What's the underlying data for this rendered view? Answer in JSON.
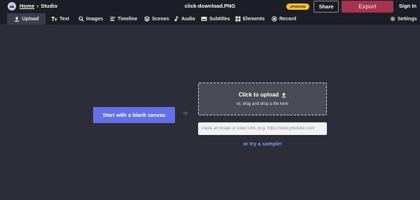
{
  "header": {
    "breadcrumb_home": "Home",
    "breadcrumb_separator": "›",
    "breadcrumb_current": "Studio",
    "file_name": "click-download.PNG",
    "upgrade_label": "UPGRADE",
    "share_label": "Share",
    "export_label": "Export",
    "signin_label": "Sign In"
  },
  "toolbar": {
    "items": [
      {
        "label": "Upload",
        "icon": "upload-icon",
        "active": true
      },
      {
        "label": "Text",
        "icon": "text-icon"
      },
      {
        "label": "Images",
        "icon": "search-icon"
      },
      {
        "label": "Timeline",
        "icon": "timeline-icon"
      },
      {
        "label": "Scenes",
        "icon": "scenes-icon"
      },
      {
        "label": "Audio",
        "icon": "music-note-icon"
      },
      {
        "label": "Subtitles",
        "icon": "subtitles-icon"
      },
      {
        "label": "Elements",
        "icon": "elements-icon"
      },
      {
        "label": "Record",
        "icon": "record-icon"
      }
    ],
    "settings_label": "Settings"
  },
  "main": {
    "blank_canvas_label": "Start with a blank canvas",
    "or_label": "or",
    "dropzone_title": "Click to upload",
    "dropzone_subtitle": "or, drag and drop a file here",
    "url_placeholder": "Paste an image or video URL (e.g. https://www.youtube.com/",
    "sample_label": "or try a sample!"
  },
  "colors": {
    "background": "#2c2d38",
    "bar": "#1c1d26",
    "accent": "#6470e6",
    "export": "#a5344f",
    "upgrade": "#f6c22f",
    "link": "#8e96ff"
  }
}
